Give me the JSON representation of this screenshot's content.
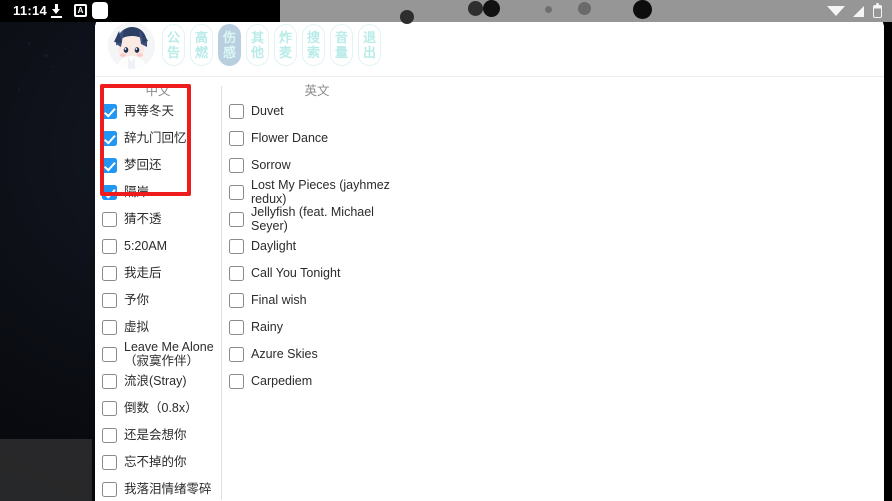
{
  "status_bar": {
    "clock": "11:14",
    "left_icons": [
      "download-icon",
      "subtitle-a-icon",
      "rounded-square-icon"
    ],
    "right_icons": [
      "wifi-icon",
      "signal-icon",
      "battery-icon"
    ],
    "a_icon_glyph": "A"
  },
  "app": {
    "avatar_name": "user-avatar",
    "nav": [
      {
        "label": "公告",
        "chars": [
          "公",
          "告"
        ],
        "active": false
      },
      {
        "label": "高燃",
        "chars": [
          "高",
          "燃"
        ],
        "active": false
      },
      {
        "label": "伤感",
        "chars": [
          "伤",
          "感"
        ],
        "active": true
      },
      {
        "label": "其他",
        "chars": [
          "其",
          "他"
        ],
        "active": false
      },
      {
        "label": "炸麦",
        "chars": [
          "炸",
          "麦"
        ],
        "active": false
      },
      {
        "label": "搜索",
        "chars": [
          "搜",
          "索"
        ],
        "active": false
      },
      {
        "label": "音量",
        "chars": [
          "音",
          "量"
        ],
        "active": false
      },
      {
        "label": "退出",
        "chars": [
          "退",
          "出"
        ],
        "active": false
      }
    ]
  },
  "columns": {
    "chinese": {
      "title": "中文",
      "items": [
        {
          "label": "再等冬天",
          "checked": true
        },
        {
          "label": "辞九门回忆",
          "checked": true
        },
        {
          "label": "梦回还",
          "checked": true
        },
        {
          "label": "隔岸",
          "checked": true
        },
        {
          "label": "猜不透",
          "checked": false
        },
        {
          "label": "5:20AM",
          "checked": false
        },
        {
          "label": "我走后",
          "checked": false
        },
        {
          "label": "予你",
          "checked": false
        },
        {
          "label": "虚拟",
          "checked": false
        },
        {
          "label": "Leave Me Alone（寂寞作伴）",
          "checked": false
        },
        {
          "label": "流浪(Stray)",
          "checked": false
        },
        {
          "label": "倒数（0.8x）",
          "checked": false
        },
        {
          "label": "还是会想你",
          "checked": false
        },
        {
          "label": "忘不掉的你",
          "checked": false
        },
        {
          "label": "我落泪情绪零碎",
          "checked": false
        }
      ]
    },
    "english": {
      "title": "英文",
      "items": [
        {
          "label": "Duvet",
          "checked": false
        },
        {
          "label": "Flower Dance",
          "checked": false
        },
        {
          "label": "Sorrow",
          "checked": false
        },
        {
          "label": "Lost My Pieces (jayhmez redux)",
          "checked": false
        },
        {
          "label": "Jellyfish (feat. Michael Seyer)",
          "checked": false
        },
        {
          "label": "Daylight",
          "checked": false
        },
        {
          "label": "Call You Tonight",
          "checked": false
        },
        {
          "label": "Final wish",
          "checked": false
        },
        {
          "label": "Rainy",
          "checked": false
        },
        {
          "label": "Azure Skies",
          "checked": false
        },
        {
          "label": "Carpediem",
          "checked": false
        }
      ]
    }
  },
  "annotation": {
    "name": "red-highlight-box",
    "color": "#ee1c1c",
    "covers": [
      "再等冬天",
      "辞九门回忆",
      "梦回还",
      "隔岸"
    ]
  },
  "colors": {
    "checkbox_checked": "#2196f3",
    "pill_text": "#b9ece8",
    "pill_active_bg": "#b9cfe0",
    "panel_bg": "#ffffff",
    "statusbar_right_bg": "#969696",
    "annotation_red": "#ee1c1c"
  }
}
